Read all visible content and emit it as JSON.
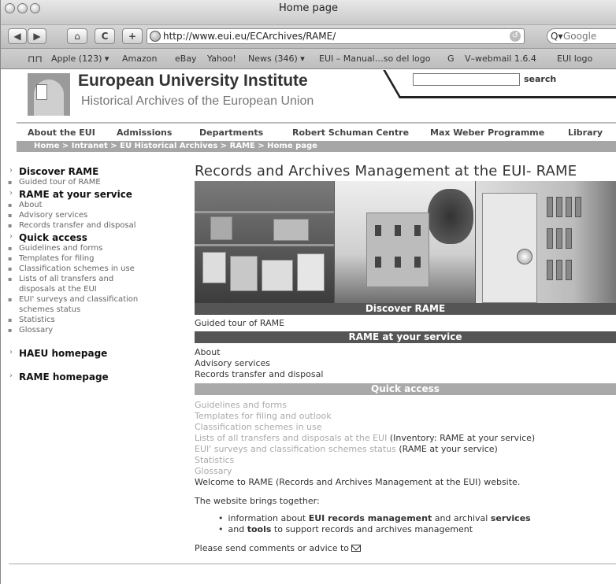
{
  "window": {
    "title": "Home page"
  },
  "toolbar": {
    "url": "http://www.eui.eu/ECArchives/RAME/",
    "search_placeholder": "Google",
    "add_label": "+",
    "reload_label": "C",
    "home_label": "⌂",
    "back_label": "◀",
    "forward_label": "▶"
  },
  "bookmarks": [
    "Apple (123) ▾",
    "Amazon",
    "eBay",
    "Yahoo!",
    "News (346) ▾",
    "EUI – Manual…so del logo",
    "G",
    "V–webmail 1.6.4",
    "EUI logo"
  ],
  "header": {
    "title": "European University Institute",
    "subtitle": "Historical Archives of the European Union",
    "search_label": "search"
  },
  "topnav": [
    "About the EUI",
    "Admissions",
    "Departments",
    "Robert Schuman Centre",
    "Max Weber Programme",
    "Library"
  ],
  "breadcrumb": "Home > Intranet > EU Historical Archives > RAME > Home page",
  "sidebar": {
    "sections": [
      {
        "label": "Discover RAME",
        "items": [
          "Guided tour of RAME"
        ]
      },
      {
        "label": "RAME at your service",
        "items": [
          "About",
          "Advisory services",
          "Records transfer and disposal"
        ]
      },
      {
        "label": "Quick access",
        "items": [
          "Guidelines and forms",
          "Templates for filing",
          "Classification schemes in use",
          "Lists of all transfers and disposals at the EUI",
          "EUI' surveys and classification schemes status",
          "Statistics",
          "Glossary"
        ]
      }
    ],
    "links": [
      "HAEU homepage",
      "RAME homepage"
    ]
  },
  "main": {
    "heading": "Records and Archives Management at the EUI- RAME",
    "bar_discover": "Discover RAME",
    "discover_items": [
      "Guided tour of RAME"
    ],
    "bar_service": "RAME at your service",
    "service_items": [
      "About",
      "Advisory services",
      "Records transfer and disposal"
    ],
    "bar_quick": "Quick access",
    "quick_items": [
      {
        "link": "Guidelines and forms",
        "note": ""
      },
      {
        "link": "Templates for filing and outlook",
        "note": ""
      },
      {
        "link": "Classification schemes in use",
        "note": ""
      },
      {
        "link": "Lists of all transfers and disposals at the EUI",
        "note": " (Inventory: RAME at your service)"
      },
      {
        "link": "EUI' surveys and classification schemes status",
        "note": " (RAME at your service)"
      },
      {
        "link": "Statistics",
        "note": ""
      },
      {
        "link": "Glossary",
        "note": ""
      }
    ],
    "welcome": "Welcome to RAME (Records and Archives Management at the EUI) website.",
    "brings": "The website brings together:",
    "bullet1": {
      "pre": "information about ",
      "b1": "EUI records management",
      "mid": " and archival ",
      "b2": "services"
    },
    "bullet2": {
      "pre": "and ",
      "b1": "tools",
      "post": " to support records and archives management"
    },
    "send": "Please send comments or advice to"
  }
}
